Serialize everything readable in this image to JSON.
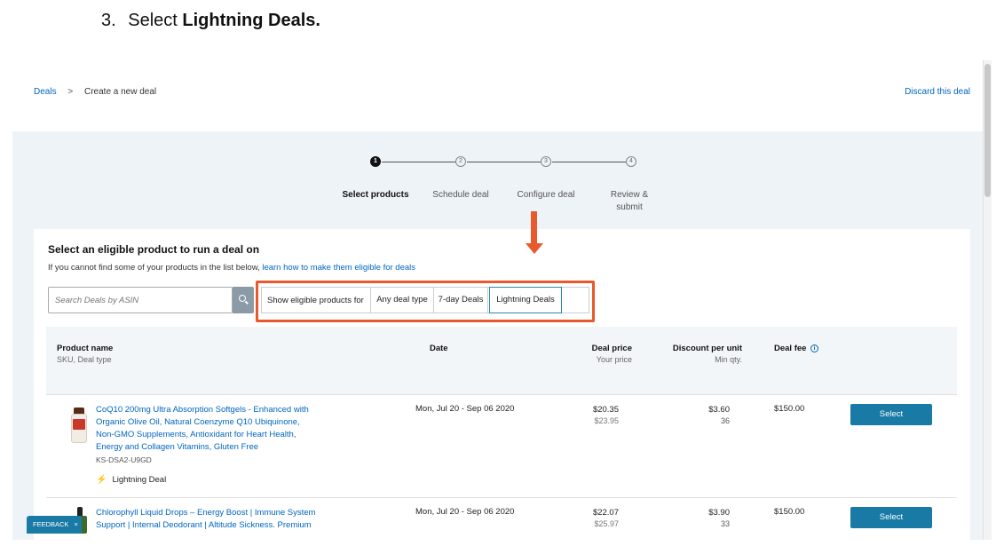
{
  "instruction": {
    "number": "3.",
    "prefix": "Select",
    "bold": "Lightning Deals."
  },
  "breadcrumb": {
    "root": "Deals",
    "separator": ">",
    "current": "Create a new deal"
  },
  "discard_label": "Discard this deal",
  "stepper": {
    "steps": [
      {
        "number": "1",
        "label": "Select products"
      },
      {
        "number": "2",
        "label": "Schedule deal"
      },
      {
        "number": "3",
        "label": "Configure deal"
      },
      {
        "number": "4",
        "label_line1": "Review &",
        "label_line2": "submit"
      }
    ],
    "active_step": 1
  },
  "card": {
    "title": "Select an eligible product to run a deal on",
    "subtitle_text": "If you cannot find some of your products in the list below,",
    "subtitle_link": "learn how to make them eligible for deals"
  },
  "search": {
    "placeholder": "Search Deals by ASIN",
    "icon": "search-icon"
  },
  "filter": {
    "label": "Show eligible products for",
    "options": [
      "Any deal type",
      "7-day Deals",
      "Lightning Deals"
    ],
    "selected": "Lightning Deals"
  },
  "annotation": {
    "color": "#e8592b",
    "shape": "down-arrow with highlight box"
  },
  "table": {
    "headers": {
      "product": "Product name",
      "product_sub": "SKU, Deal type",
      "date": "Date",
      "price": "Deal price",
      "price_sub": "Your price",
      "discount": "Discount per unit",
      "discount_sub": "Min qty.",
      "fee": "Deal fee",
      "fee_icon": "info-icon"
    },
    "rows": [
      {
        "name_line1": "CoQ10 200mg Ultra Absorption Softgels - Enhanced with",
        "name_line2": "Organic Olive Oil, Natural Coenzyme Q10 Ubiquinone,",
        "name_line3": "Non-GMO Supplements, Antioxidant for Heart Health,",
        "name_line4": "Energy and Collagen Vitamins, Gluten Free",
        "sku": "KS-DSA2-U9GD",
        "deal_type": "Lightning Deal",
        "date": "Mon, Jul 20 - Sep 06 2020",
        "deal_price": "$20.35",
        "your_price": "$23.95",
        "discount": "$3.60",
        "min_qty": "36",
        "fee": "$150.00",
        "button": "Select"
      },
      {
        "name_line1": "Chlorophyll Liquid Drops – Energy Boost | Immune System",
        "name_line2": "Support | Internal Deodorant | Altitude Sickness. Premium",
        "date": "Mon, Jul 20 - Sep 06 2020",
        "deal_price": "$22.07",
        "your_price": "$25.97",
        "discount": "$3.90",
        "min_qty": "33",
        "fee": "$150.00",
        "button": "Select"
      }
    ]
  },
  "feedback": {
    "label": "FEEDBACK",
    "close": "×"
  }
}
